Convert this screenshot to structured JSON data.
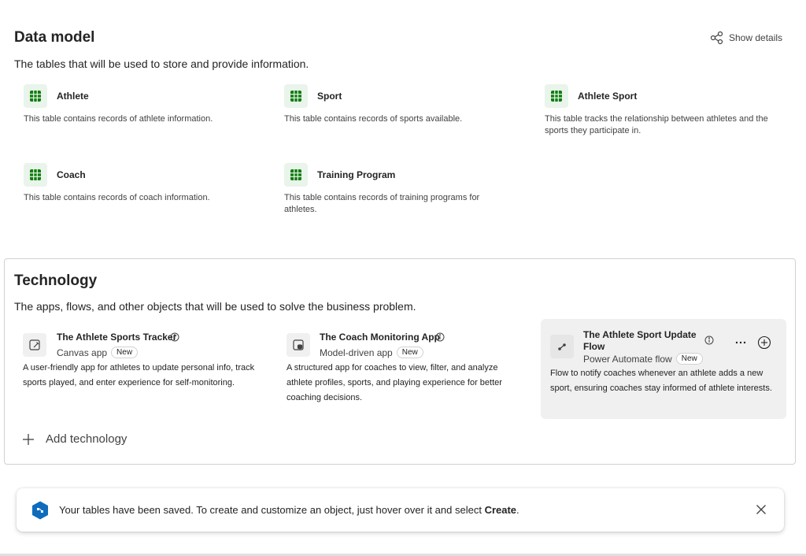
{
  "data_model": {
    "title": "Data model",
    "subtitle": "The tables that will be used to store and provide information.",
    "show_details_label": "Show details",
    "tables": [
      {
        "name": "Athlete",
        "description": "This table contains records of athlete information."
      },
      {
        "name": "Sport",
        "description": "This table contains records of sports available."
      },
      {
        "name": "Athlete Sport",
        "description": "This table tracks the relationship between athletes and the sports they participate in."
      },
      {
        "name": "Coach",
        "description": "This table contains records of coach information."
      },
      {
        "name": "Training Program",
        "description": "This table contains records of training programs for athletes."
      }
    ]
  },
  "technology": {
    "title": "Technology",
    "subtitle": "The apps, flows, and other objects that will be used to solve the business problem.",
    "items": [
      {
        "name": "The Athlete Sports Tracker",
        "type": "Canvas app",
        "badge": "New",
        "description": "A user-friendly app for athletes to update personal info, track sports played, and enter experience for self-monitoring.",
        "icon": "canvas-app-icon"
      },
      {
        "name": "The Coach Monitoring App",
        "type": "Model-driven app",
        "badge": "New",
        "description": "A structured app for coaches to view, filter, and analyze athlete profiles, sports, and playing experience for better coaching decisions.",
        "icon": "model-driven-app-icon"
      },
      {
        "name": "The Athlete Sport Update Flow",
        "type": "Power Automate flow",
        "badge": "New",
        "description": "Flow to notify coaches whenever an athlete adds a new sport, ensuring coaches stay informed of athlete interests.",
        "icon": "flow-icon"
      }
    ],
    "add_label": "Add technology"
  },
  "toast": {
    "message_prefix": "Your tables have been saved. To create and customize an object, just hover over it and select ",
    "message_bold": "Create",
    "message_suffix": "."
  },
  "colors": {
    "table_icon_green": "#107c10",
    "table_icon_bg": "#e9f4ea",
    "highlight_bg": "#f0f0f0",
    "toast_icon_blue": "#0f6cbd"
  }
}
